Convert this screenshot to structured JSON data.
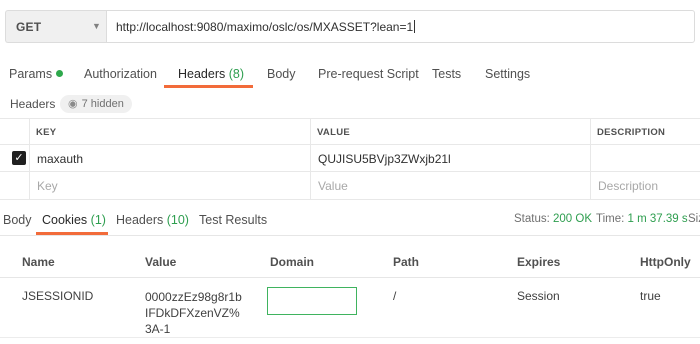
{
  "request": {
    "method": "GET",
    "url": "http://localhost:9080/maximo/oslc/os/MXASSET?lean=1"
  },
  "request_tabs": [
    {
      "label": "Params"
    },
    {
      "label": "Authorization"
    },
    {
      "label": "Headers",
      "count": "(8)"
    },
    {
      "label": "Body"
    },
    {
      "label": "Pre-request Script"
    },
    {
      "label": "Tests"
    },
    {
      "label": "Settings"
    }
  ],
  "headers_section": {
    "title": "Headers",
    "hidden": "7 hidden",
    "columns": [
      "KEY",
      "VALUE",
      "DESCRIPTION"
    ],
    "rows": [
      {
        "key": "maxauth",
        "value": "QUJISU5BVjp3ZWxjb21l",
        "description": ""
      }
    ],
    "placeholder": {
      "key": "Key",
      "value": "Value",
      "description": "Description"
    }
  },
  "response_tabs": [
    {
      "label": "Body"
    },
    {
      "label": "Cookies",
      "count": "(1)"
    },
    {
      "label": "Headers",
      "count": "(10)"
    },
    {
      "label": "Test Results"
    }
  ],
  "response_status": {
    "status_label": "Status:",
    "status_value": "200 OK",
    "time_label": "Time:",
    "time_value": "1 m 37.39 s",
    "size_label": "Siz"
  },
  "cookies": {
    "columns": [
      "Name",
      "Value",
      "Domain",
      "Path",
      "Expires",
      "HttpOnly"
    ],
    "rows": [
      {
        "name": "JSESSIONID",
        "value": "0000zzEz98g8r1bIFDkDFXzenVZ%3A-1",
        "domain": "",
        "path": "/",
        "expires": "Session",
        "httponly": "true"
      }
    ]
  },
  "colors": {
    "accent": "#f26b3a",
    "success": "#2e9e4f"
  },
  "icons": {
    "method_dropdown": "caret-down-icon",
    "hidden_headers": "eye-icon",
    "row_enabled": "checkbox-checked-icon"
  }
}
